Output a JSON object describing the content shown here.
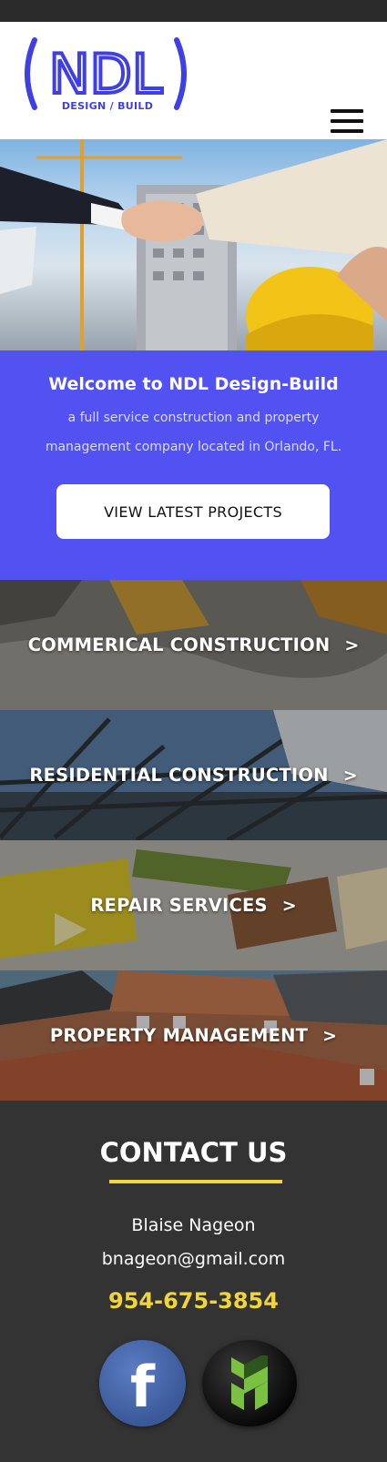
{
  "logo": {
    "mark": "NDL",
    "tagline": "DESIGN / BUILD",
    "color": "#3f3fe6"
  },
  "menu": {
    "icon": "hamburger-menu-icon"
  },
  "welcome": {
    "title": "Welcome to NDL Design-Build",
    "subtitle_line1": "a full service construction and property",
    "subtitle_line2": "management company located in Orlando, FL.",
    "cta_label": "VIEW LATEST PROJECTS",
    "background": "#5252f2"
  },
  "services": [
    {
      "label": "COMMERICAL CONSTRUCTION",
      "arrow": ">"
    },
    {
      "label": "RESIDENTIAL CONSTRUCTION",
      "arrow": ">"
    },
    {
      "label": "REPAIR SERVICES",
      "arrow": ">"
    },
    {
      "label": "PROPERTY MANAGEMENT",
      "arrow": ">"
    }
  ],
  "contact": {
    "title": "CONTACT US",
    "name": "Blaise Nageon",
    "email": "bnageon@gmail.com",
    "phone": "954-675-3854",
    "accent": "#f2d53c"
  },
  "social": {
    "facebook": {
      "icon": "facebook-icon",
      "glyph": "f"
    },
    "houzz": {
      "icon": "houzz-icon"
    }
  }
}
